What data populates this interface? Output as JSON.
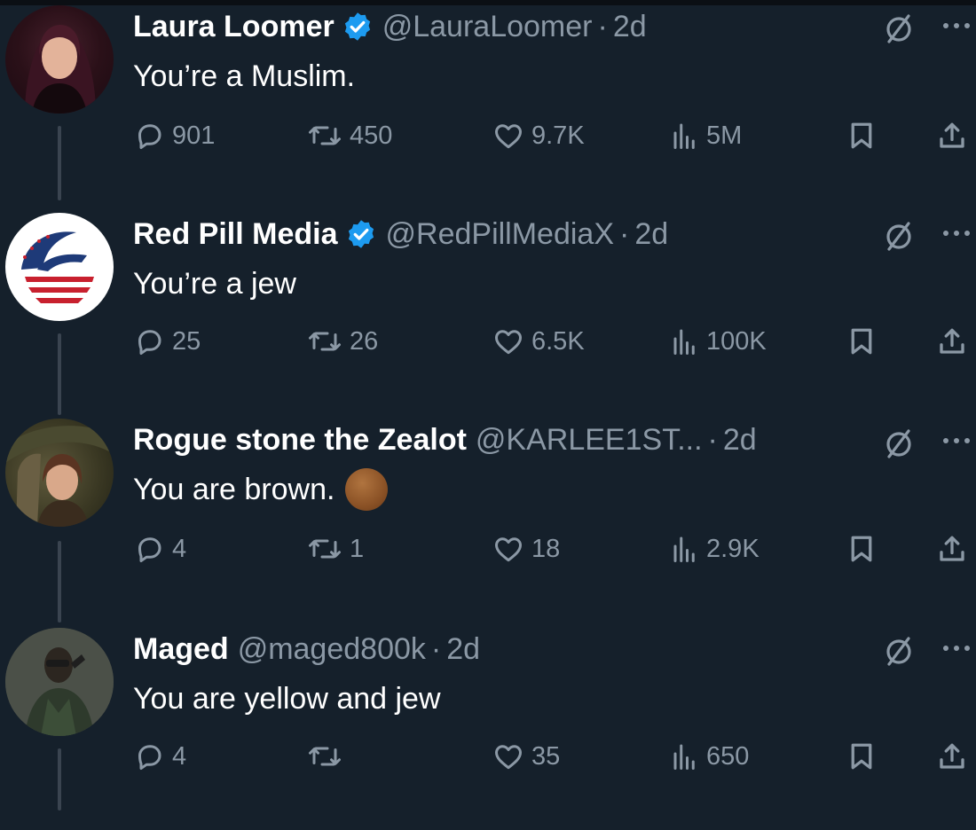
{
  "colors": {
    "background": "#15202b",
    "text": "#e7e9ea",
    "muted": "#8b98a5",
    "verified": "#1d9bf0"
  },
  "icons": {
    "reply": "speech-bubble-icon",
    "retweet": "retweet-arrows-icon",
    "like": "heart-icon",
    "views": "bar-chart-icon",
    "bookmark": "bookmark-icon",
    "share": "share-upload-icon",
    "grok": "grok-slash-circle-icon",
    "more": "ellipsis-icon"
  },
  "tweets": [
    {
      "name": "Laura Loomer",
      "verified": true,
      "handle": "@LauraLoomer",
      "separator": "·",
      "time": "2d",
      "text": "You’re a Muslim.",
      "replies": "901",
      "retweets": "450",
      "likes": "9.7K",
      "views": "5M"
    },
    {
      "name": "Red Pill Media",
      "verified": true,
      "handle": "@RedPillMediaX",
      "separator": "·",
      "time": "2d",
      "text": "You’re a jew",
      "replies": "25",
      "retweets": "26",
      "likes": "6.5K",
      "views": "100K"
    },
    {
      "name": "Rogue stone the Zealot",
      "verified": false,
      "handle": "@KARLEE1ST...",
      "separator": "·",
      "time": "2d",
      "text": "You are brown.",
      "replies": "4",
      "retweets": "1",
      "likes": "18",
      "views": "2.9K"
    },
    {
      "name": "Maged",
      "verified": false,
      "handle": "@maged800k",
      "separator": "·",
      "time": "2d",
      "text": "You are yellow and jew",
      "replies": "4",
      "retweets": "",
      "likes": "35",
      "views": "650"
    }
  ]
}
